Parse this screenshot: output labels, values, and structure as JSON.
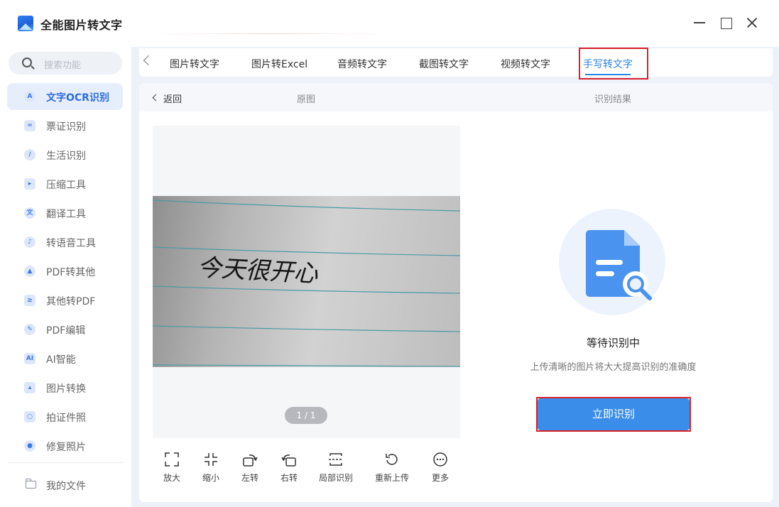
{
  "app": {
    "title": "全能图片转文字"
  },
  "window": {
    "minimize": "minimize-icon",
    "maximize": "maximize-icon",
    "close": "close-icon"
  },
  "sidebar": {
    "search_placeholder": "搜索功能",
    "items": [
      {
        "label": "文字OCR识别",
        "icon": "A",
        "active": true
      },
      {
        "label": "票证识别",
        "icon": "="
      },
      {
        "label": "生活识别",
        "icon": "/"
      },
      {
        "label": "压缩工具",
        "icon": "▸"
      },
      {
        "label": "翻译工具",
        "icon": "文"
      },
      {
        "label": "转语音工具",
        "icon": "♪"
      },
      {
        "label": "PDF转其他",
        "icon": "▲"
      },
      {
        "label": "其他转PDF",
        "icon": "≥"
      },
      {
        "label": "PDF编辑",
        "icon": "✎"
      },
      {
        "label": "AI智能",
        "icon": "AI"
      },
      {
        "label": "图片转换",
        "icon": "▴"
      },
      {
        "label": "拍证件照",
        "icon": "○"
      },
      {
        "label": "修复照片",
        "icon": "●"
      }
    ],
    "my_files": "我的文件"
  },
  "tabs": [
    {
      "label": "图片转文字"
    },
    {
      "label": "图片转Excel"
    },
    {
      "label": "音频转文字"
    },
    {
      "label": "截图转文字"
    },
    {
      "label": "视频转文字"
    },
    {
      "label": "手写转文字",
      "active": true
    }
  ],
  "panel": {
    "back": "返回",
    "original": "原图",
    "result": "识别结果",
    "page_indicator": "1 / 1",
    "handwriting_text": "今天很开心",
    "tools": [
      {
        "label": "放大",
        "icon": "expand-icon"
      },
      {
        "label": "缩小",
        "icon": "shrink-icon"
      },
      {
        "label": "左转",
        "icon": "rotate-left-icon"
      },
      {
        "label": "右转",
        "icon": "rotate-right-icon"
      },
      {
        "label": "局部识别",
        "icon": "crop-icon"
      },
      {
        "label": "重新上传",
        "icon": "reupload-icon"
      },
      {
        "label": "更多",
        "icon": "more-icon"
      }
    ],
    "status": "等待识别中",
    "hint": "上传清晰的图片将大大提高识别的准确度",
    "recognize_button": "立即识别"
  },
  "colors": {
    "accent": "#2b84e6",
    "button": "#3a8ee9",
    "highlight": "#d8222b",
    "active_bg": "#e7eefb"
  }
}
